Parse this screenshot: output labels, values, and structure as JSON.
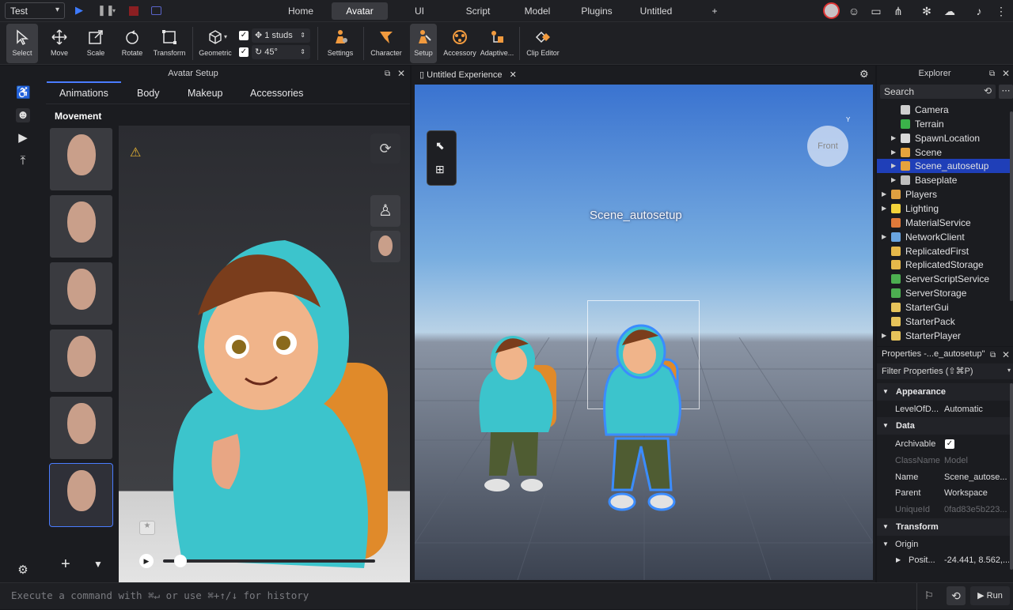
{
  "topbar": {
    "place": "Test",
    "tabs": [
      "Home",
      "Avatar",
      "UI",
      "Script",
      "Model",
      "Plugins",
      "Untitled",
      "+"
    ],
    "active_tab": "Avatar"
  },
  "toolbar": {
    "select": "Select",
    "move": "Move",
    "scale": "Scale",
    "rotate": "Rotate",
    "transform": "Transform",
    "geometric": "Geometric",
    "move_snap": "1 studs",
    "rotate_snap": "45°",
    "settings": "Settings",
    "character": "Character",
    "setup": "Setup",
    "accessory": "Accessory",
    "adaptive": "Adaptive...",
    "clip_editor": "Clip Editor"
  },
  "avatar_panel": {
    "title": "Avatar Setup",
    "tabs": [
      "Animations",
      "Body",
      "Makeup",
      "Accessories"
    ],
    "section": "Movement"
  },
  "viewport": {
    "tab": "Untitled Experience",
    "model_label": "Scene_autosetup",
    "gizmo_label": "Front",
    "gizmo_axis": "Y"
  },
  "explorer": {
    "title": "Explorer",
    "search_placeholder": "Search",
    "items": [
      {
        "label": "Camera",
        "icon": "camera-icon",
        "indent": 2,
        "arrow": false
      },
      {
        "label": "Terrain",
        "icon": "terrain-icon",
        "indent": 2,
        "arrow": false
      },
      {
        "label": "SpawnLocation",
        "icon": "spawn-icon",
        "indent": 2,
        "arrow": true
      },
      {
        "label": "Scene",
        "icon": "model-icon",
        "indent": 2,
        "arrow": true
      },
      {
        "label": "Scene_autosetup",
        "icon": "model-icon",
        "indent": 2,
        "arrow": true
      },
      {
        "label": "Baseplate",
        "icon": "part-icon",
        "indent": 2,
        "arrow": true
      },
      {
        "label": "Players",
        "icon": "players-icon",
        "indent": 1,
        "arrow": true
      },
      {
        "label": "Lighting",
        "icon": "lighting-icon",
        "indent": 1,
        "arrow": true
      },
      {
        "label": "MaterialService",
        "icon": "material-icon",
        "indent": 1,
        "arrow": false
      },
      {
        "label": "NetworkClient",
        "icon": "network-icon",
        "indent": 1,
        "arrow": true
      },
      {
        "label": "ReplicatedFirst",
        "icon": "replicated-icon",
        "indent": 1,
        "arrow": false
      },
      {
        "label": "ReplicatedStorage",
        "icon": "replicated-icon",
        "indent": 1,
        "arrow": false
      },
      {
        "label": "ServerScriptService",
        "icon": "server-icon",
        "indent": 1,
        "arrow": false
      },
      {
        "label": "ServerStorage",
        "icon": "server-icon",
        "indent": 1,
        "arrow": false
      },
      {
        "label": "StarterGui",
        "icon": "folder-icon",
        "indent": 1,
        "arrow": false
      },
      {
        "label": "StarterPack",
        "icon": "folder-icon",
        "indent": 1,
        "arrow": false
      },
      {
        "label": "StarterPlayer",
        "icon": "folder-icon",
        "indent": 1,
        "arrow": true
      }
    ]
  },
  "properties": {
    "title": "Properties -...e_autosetup\"",
    "filter_placeholder": "Filter Properties (⇧⌘P)",
    "appearance": "Appearance",
    "level_key": "LevelOfD...",
    "level_val": "Automatic",
    "data": "Data",
    "archivable_key": "Archivable",
    "classname_key": "ClassName",
    "classname_val": "Model",
    "name_key": "Name",
    "name_val": "Scene_autose...",
    "parent_key": "Parent",
    "parent_val": "Workspace",
    "uniqueid_key": "UniqueId",
    "uniqueid_val": "0fad83e5b223...",
    "transform": "Transform",
    "origin_key": "Origin",
    "position_key": "Posit...",
    "position_val": "-24.441, 8.562,..."
  },
  "cmdbar": {
    "placeholder": "Execute a command with ⌘↵ or use ⌘+↑/↓ for history",
    "run": "Run"
  },
  "colors": {
    "accent": "#4a7cff",
    "selected_row": "#1f3fb8",
    "hoodie": "#3cc4cc",
    "backpack": "#e08a2a"
  }
}
